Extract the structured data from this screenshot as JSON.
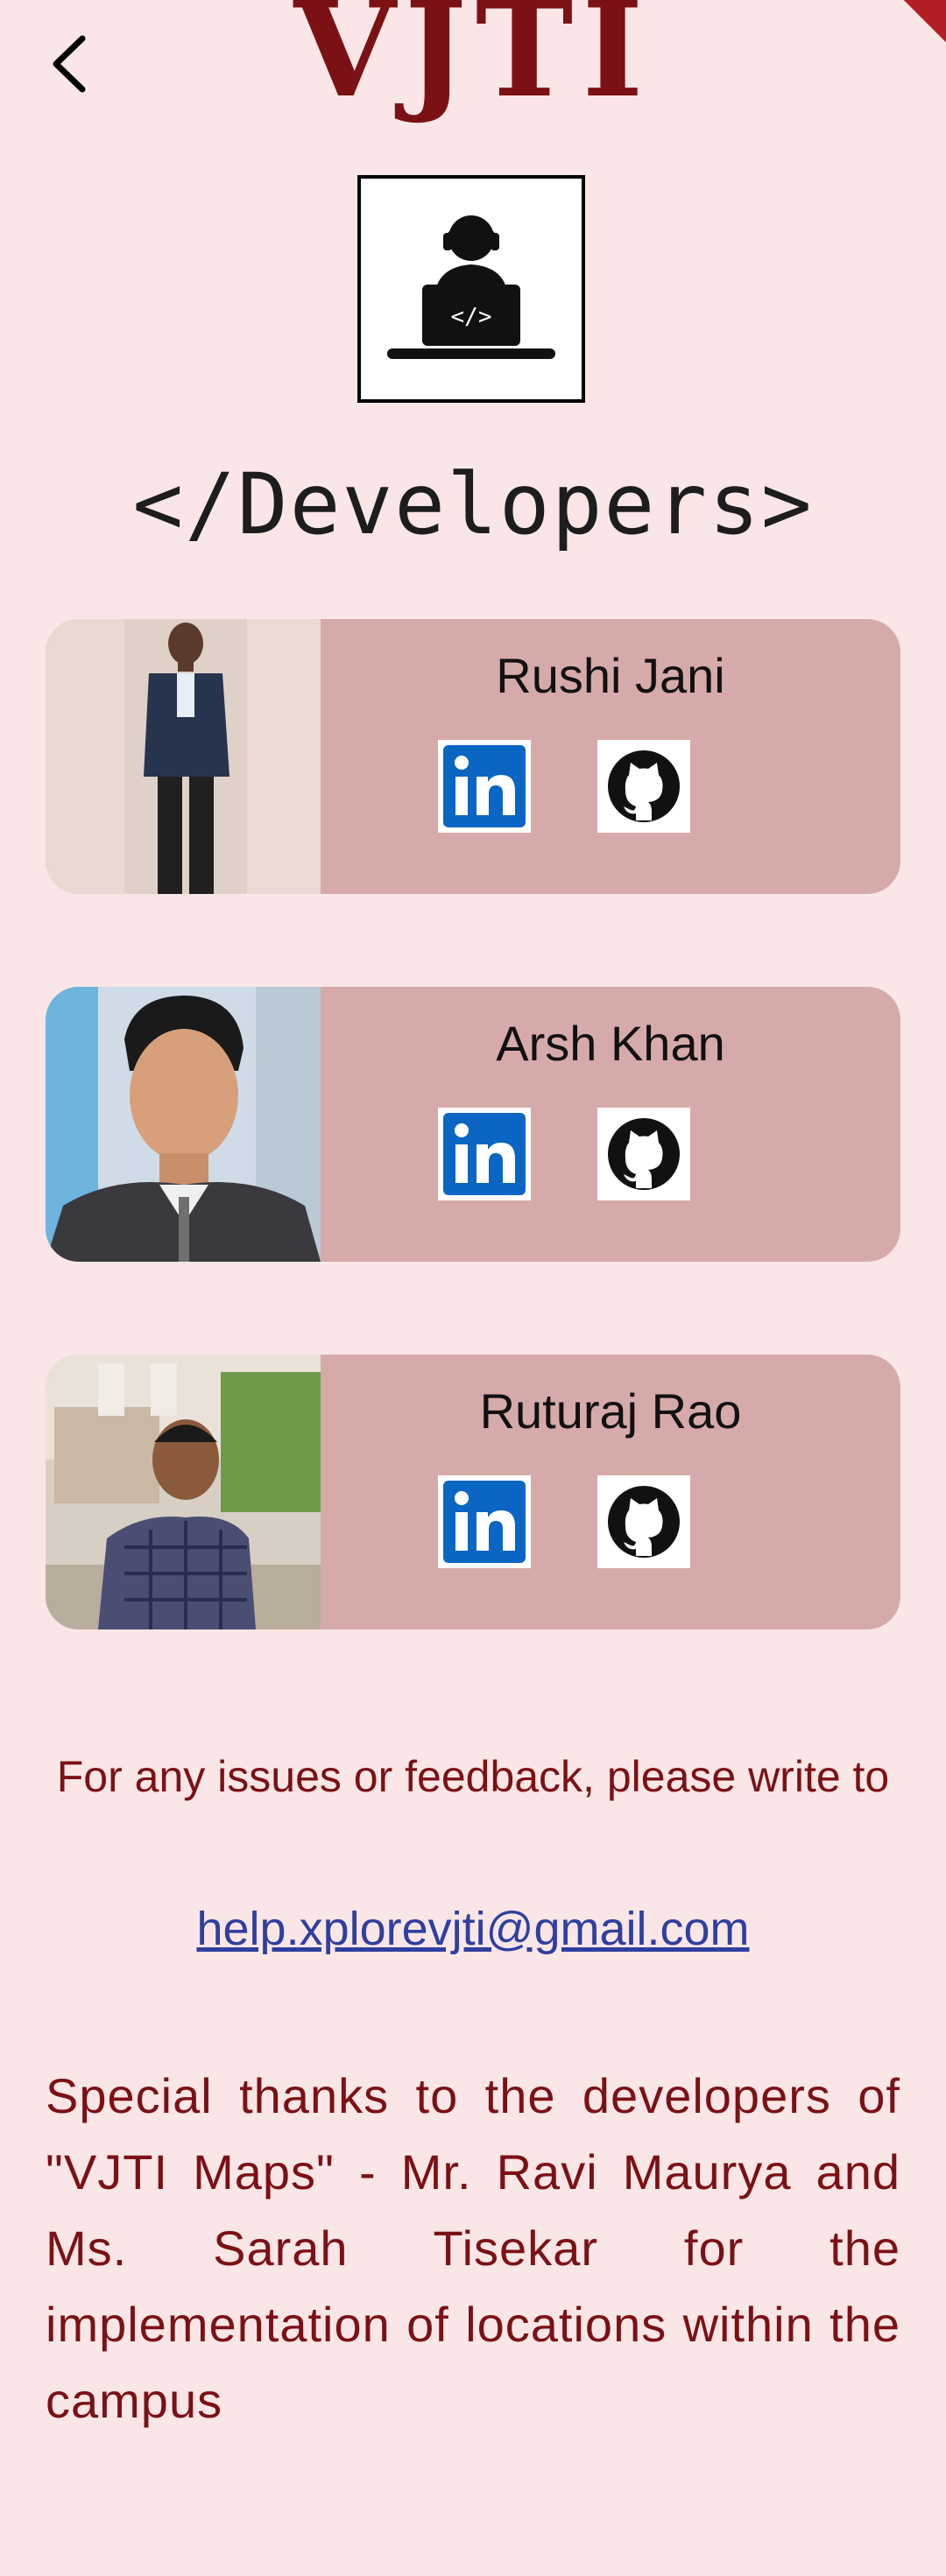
{
  "header": {
    "logo_text": "VJTI",
    "back_icon": "chevron-left-icon"
  },
  "hero": {
    "icon": "developer-laptop-icon",
    "title": "</Developers>"
  },
  "developers": [
    {
      "name": "Rushi Jani",
      "photo": "person-photo",
      "links": [
        "linkedin-icon",
        "github-icon"
      ]
    },
    {
      "name": "Arsh Khan",
      "photo": "person-photo",
      "links": [
        "linkedin-icon",
        "github-icon"
      ]
    },
    {
      "name": "Ruturaj Rao",
      "photo": "person-photo",
      "links": [
        "linkedin-icon",
        "github-icon"
      ]
    }
  ],
  "feedback": {
    "text": "For any issues or feedback, please write to",
    "email": "help.xplorevjti@gmail.com"
  },
  "thanks": "Special thanks to the developers of \"VJTI Maps\" - Mr. Ravi Maurya and Ms. Sarah Tisekar for the implementation of locations within the campus",
  "colors": {
    "background": "#fae6e6",
    "card": "#d7aaaa",
    "brand": "#7b1115",
    "link": "#2f3fa0",
    "linkedin": "#0a66c2"
  }
}
